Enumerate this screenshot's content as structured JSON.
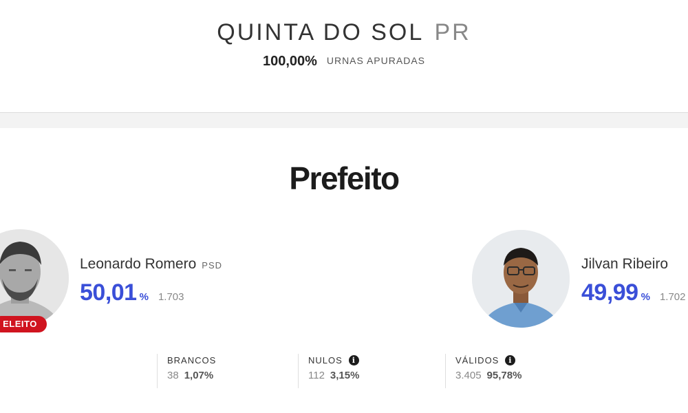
{
  "header": {
    "city": "QUINTA DO SOL",
    "state": "PR",
    "urnas_pct": "100,00%",
    "urnas_label": "URNAS APURADAS"
  },
  "office": "Prefeito",
  "candidates": [
    {
      "name": "Leonardo Romero",
      "party": "PSD",
      "percent": "50,01",
      "percent_sign": "%",
      "votes": "1.703",
      "badge": "ELEITO"
    },
    {
      "name": "Jilvan Ribeiro",
      "party": "",
      "percent": "49,99",
      "percent_sign": "%",
      "votes": "1.702"
    }
  ],
  "stats": [
    {
      "label": "BRANCOS",
      "count": "38",
      "percent": "1,07%",
      "info_icon": false
    },
    {
      "label": "NULOS",
      "count": "112",
      "percent": "3,15%",
      "info_icon": true
    },
    {
      "label": "VÁLIDOS",
      "count": "3.405",
      "percent": "95,78%",
      "info_icon": true
    }
  ],
  "colors": {
    "accent_percent": "#3a4fd8",
    "elected_badge": "#d0141f"
  },
  "icons": {
    "info": "i"
  }
}
